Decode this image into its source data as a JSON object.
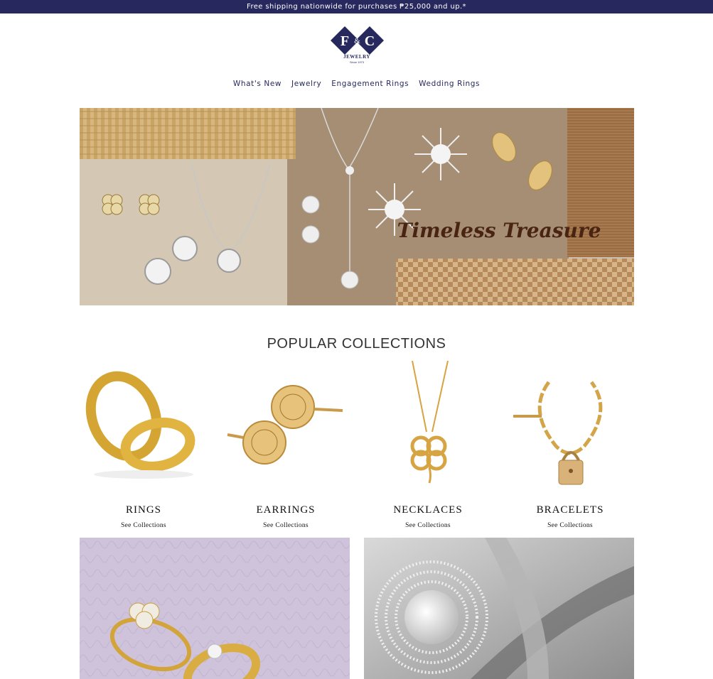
{
  "announcement": "Free shipping nationwide for purchases ₱25,000 and up.*",
  "brand": {
    "logo_letters": "F&C",
    "logo_word": "JEWELRY",
    "logo_since": "Since 1973",
    "color_navy": "#26285e"
  },
  "nav": {
    "items": [
      "What's New",
      "Jewelry",
      "Engagement Rings",
      "Wedding Rings"
    ]
  },
  "hero": {
    "script_text": "Timeless Treasure"
  },
  "popular": {
    "title": "POPULAR COLLECTIONS",
    "items": [
      {
        "name": "RINGS",
        "link": "See Collections"
      },
      {
        "name": "EARRINGS",
        "link": "See Collections"
      },
      {
        "name": "NECKLACES",
        "link": "See Collections"
      },
      {
        "name": "BRACELETS",
        "link": "See Collections"
      }
    ]
  }
}
